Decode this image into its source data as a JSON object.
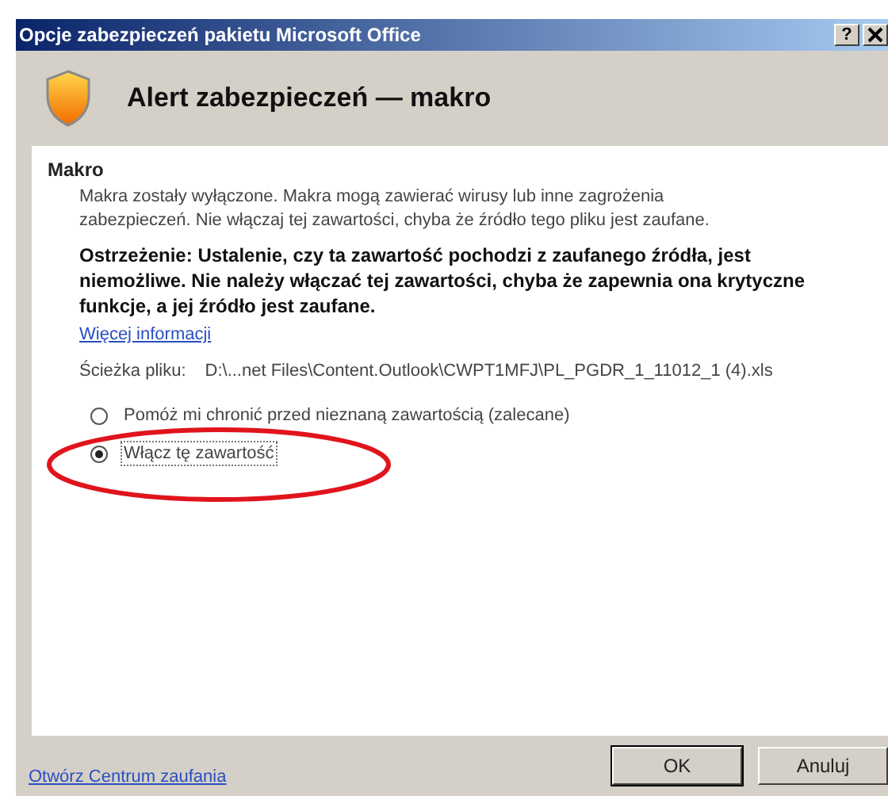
{
  "window": {
    "title": "Opcje zabezpieczeń pakietu Microsoft Office",
    "help_button": "?"
  },
  "header": {
    "title": "Alert zabezpieczeń — makro"
  },
  "section": {
    "title": "Makro",
    "description": "Makra zostały wyłączone. Makra mogą zawierać wirusy lub inne zagrożenia zabezpieczeń. Nie włączaj tej zawartości, chyba że źródło tego pliku jest zaufane.",
    "warning": "Ostrzeżenie: Ustalenie, czy ta zawartość pochodzi z zaufanego źródła, jest niemożliwe. Nie należy włączać tej zawartości, chyba że zapewnia ona krytyczne funkcje, a jej źródło jest zaufane.",
    "more_link": "Więcej informacji",
    "path_label": "Ścieżka pliku:",
    "path_value": "D:\\...net Files\\Content.Outlook\\CWPT1MFJ\\PL_PGDR_1_11012_1 (4).xls",
    "options": [
      {
        "label": "Pomóż mi chronić przed nieznaną zawartością (zalecane)",
        "selected": false
      },
      {
        "label": "Włącz tę zawartość",
        "selected": true
      }
    ]
  },
  "footer": {
    "link": "Otwórz Centrum zaufania",
    "buttons": [
      {
        "label": "OK",
        "default": true
      },
      {
        "label": "Anuluj",
        "default": false
      }
    ]
  }
}
